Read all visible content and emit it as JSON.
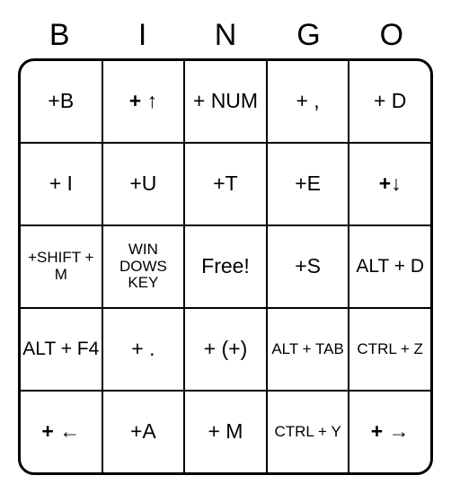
{
  "header": [
    "B",
    "I",
    "N",
    "G",
    "O"
  ],
  "cells": [
    [
      {
        "text": "+B",
        "size": "normal"
      },
      {
        "text": "+ ↑",
        "size": "normal",
        "arrow": true
      },
      {
        "text": "+ NUM",
        "size": "normal"
      },
      {
        "text": "+ ,",
        "size": "normal"
      },
      {
        "text": "+ D",
        "size": "normal"
      }
    ],
    [
      {
        "text": "+ I",
        "size": "normal"
      },
      {
        "text": "+U",
        "size": "normal"
      },
      {
        "text": "+T",
        "size": "normal"
      },
      {
        "text": "+E",
        "size": "normal"
      },
      {
        "text": "+↓",
        "size": "normal",
        "arrow": true
      }
    ],
    [
      {
        "text": "+SHIFT + M",
        "size": "small"
      },
      {
        "text": "WIN DOWS KEY",
        "size": "small"
      },
      {
        "text": "Free!",
        "size": "normal"
      },
      {
        "text": "+S",
        "size": "normal"
      },
      {
        "text": "ALT + D",
        "size": "med"
      }
    ],
    [
      {
        "text": "ALT + F4",
        "size": "med"
      },
      {
        "text": "+ .",
        "size": "normal"
      },
      {
        "text": "+ (+)",
        "size": "normal"
      },
      {
        "text": "ALT + TAB",
        "size": "small"
      },
      {
        "text": "CTRL + Z",
        "size": "small"
      }
    ],
    [
      {
        "text": "+ ←",
        "size": "normal",
        "arrow": true
      },
      {
        "text": "+A",
        "size": "normal"
      },
      {
        "text": "+ M",
        "size": "normal"
      },
      {
        "text": "CTRL + Y",
        "size": "small"
      },
      {
        "text": "+ →",
        "size": "normal",
        "arrow": true
      }
    ]
  ]
}
